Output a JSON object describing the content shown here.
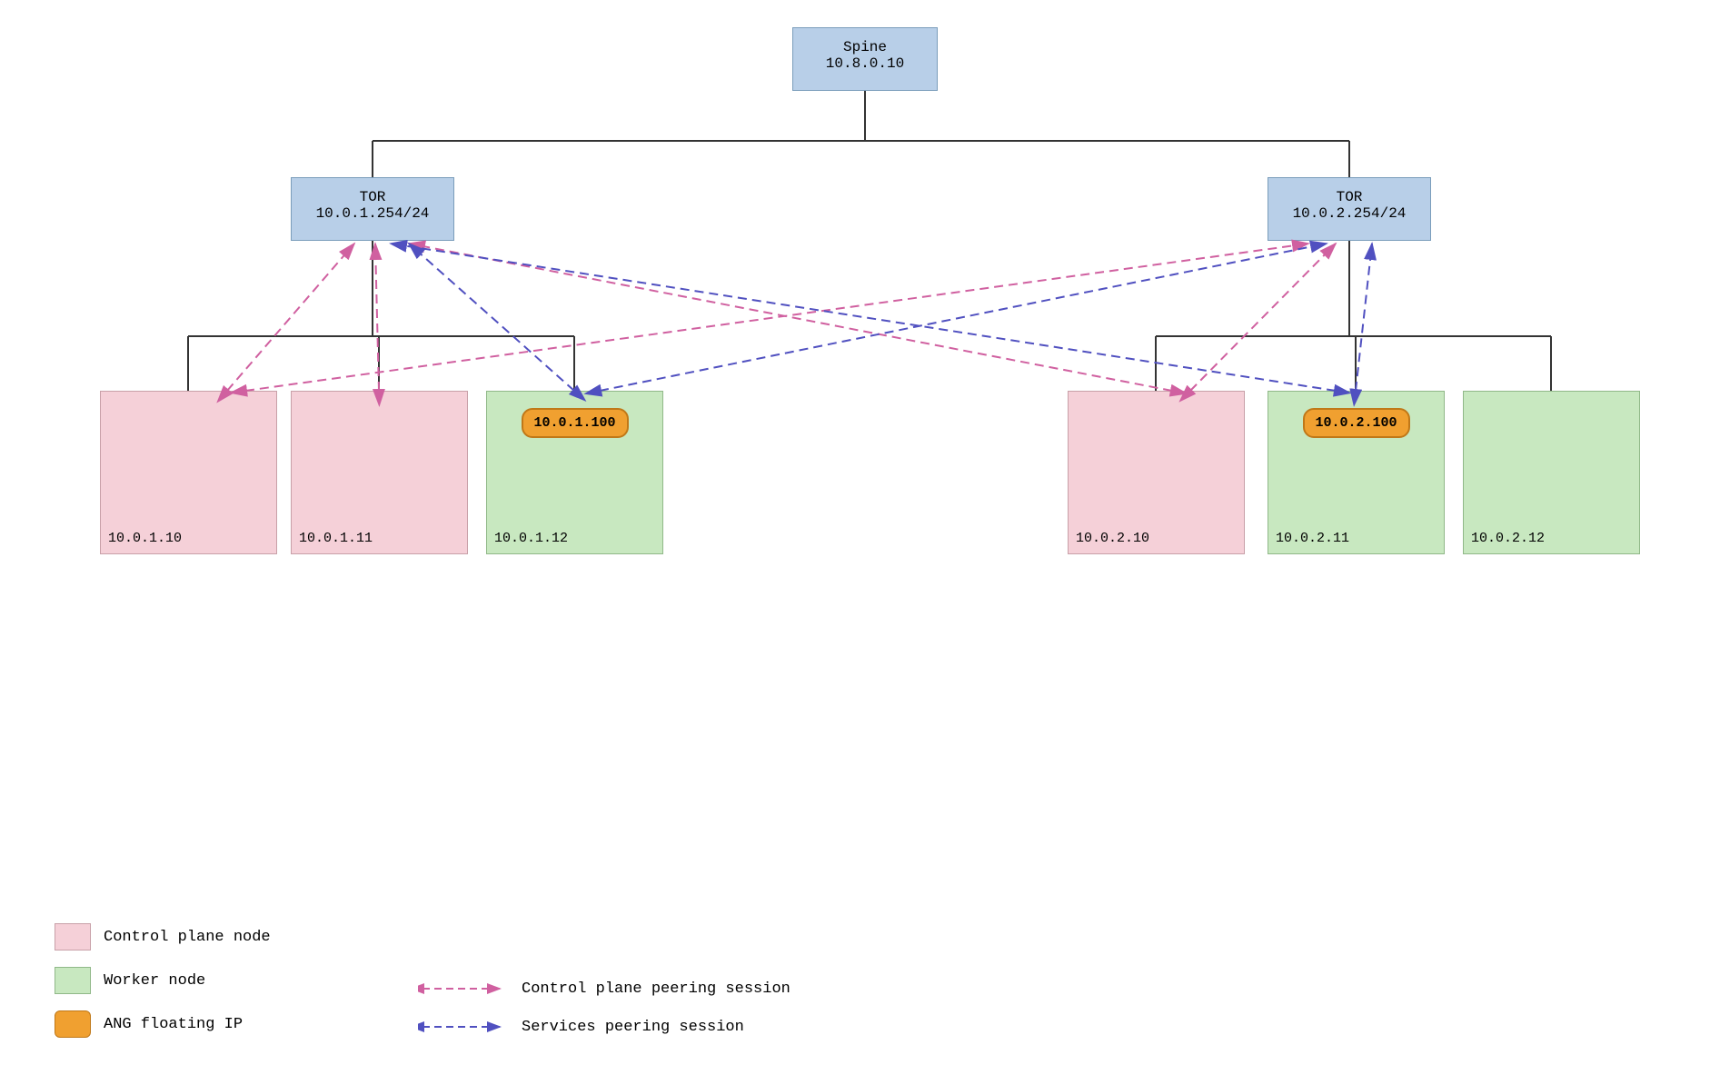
{
  "nodes": {
    "spine": {
      "label": "Spine",
      "ip": "10.8.0.10"
    },
    "tor_left": {
      "label": "TOR",
      "ip": "10.0.1.254/24"
    },
    "tor_right": {
      "label": "TOR",
      "ip": "10.0.2.254/24"
    },
    "n1": {
      "ip": "10.0.1.10",
      "type": "control"
    },
    "n2": {
      "ip": "10.0.1.11",
      "type": "control"
    },
    "n3": {
      "ip": "10.0.1.12",
      "type": "worker",
      "floating": "10.0.1.100"
    },
    "n4": {
      "ip": "10.0.2.10",
      "type": "control"
    },
    "n5": {
      "ip": "10.0.2.11",
      "type": "worker",
      "floating": "10.0.2.100"
    },
    "n6": {
      "ip": "10.0.2.12",
      "type": "worker"
    }
  },
  "legend": {
    "control_label": "Control plane node",
    "worker_label": "Worker node",
    "floating_label": "ANG floating IP",
    "cp_peering_label": "Control plane peering session",
    "svc_peering_label": "Services peering session"
  }
}
